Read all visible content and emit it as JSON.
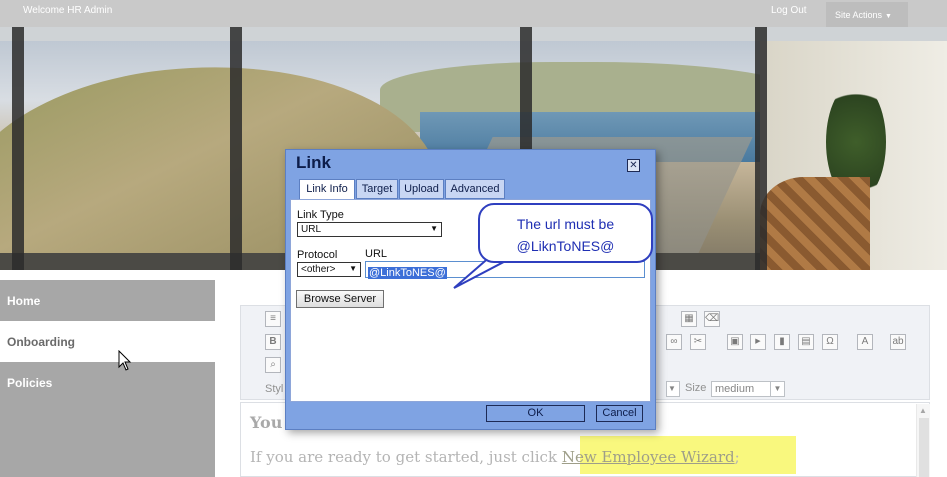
{
  "topbar": {
    "welcome": "Welcome HR Admin",
    "logout": "Log Out",
    "site_actions": "Site Actions"
  },
  "nav": {
    "items": [
      {
        "label": "Home"
      },
      {
        "label": "Onboarding"
      },
      {
        "label": "Policies"
      }
    ]
  },
  "editor": {
    "style_label": "Styl",
    "size_label": "Size",
    "size_value": "medium",
    "heading": "You",
    "line_prefix": "If you are ready to get started, just click ",
    "link_text": "New Employee Wizard",
    "line_suffix": ";"
  },
  "dialog": {
    "title": "Link",
    "tabs": [
      {
        "label": "Link Info"
      },
      {
        "label": "Target"
      },
      {
        "label": "Upload"
      },
      {
        "label": "Advanced"
      }
    ],
    "link_type_label": "Link Type",
    "link_type_value": "URL",
    "protocol_label": "Protocol",
    "protocol_value": "<other>",
    "url_label": "URL",
    "url_value": "@LinkToNES@",
    "browse_label": "Browse Server",
    "ok_label": "OK",
    "cancel_label": "Cancel"
  },
  "callout": {
    "line1": "The url must be",
    "line2": "@LiknToNES@"
  },
  "colors": {
    "dialog_bg": "#7fa3e3",
    "highlight": "#f6f43a",
    "callout_text": "#1f2fb3",
    "nav_gray": "#a7a7a7"
  }
}
